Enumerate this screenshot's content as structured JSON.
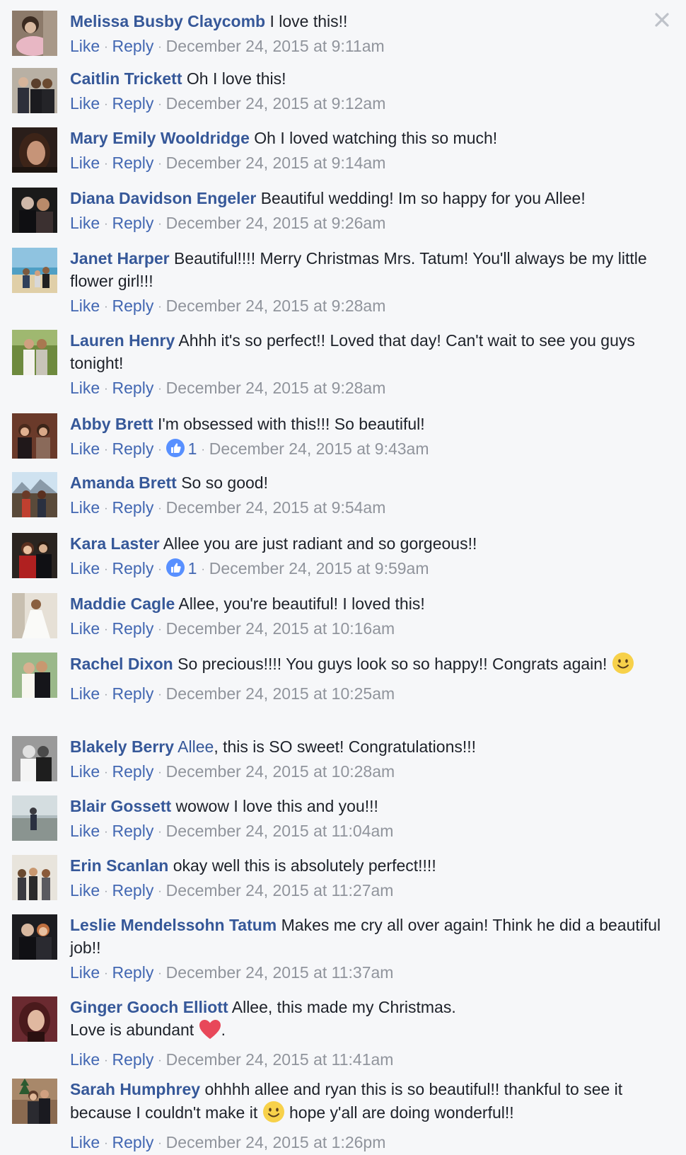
{
  "actions": {
    "like": "Like",
    "reply": "Reply",
    "separator": "·"
  },
  "comments": [
    {
      "author": "Melissa Busby Claycomb",
      "text": "I love this!!",
      "time": "December 24, 2015 at 9:11am"
    },
    {
      "author": "Caitlin Trickett",
      "text": "Oh I love this!",
      "time": "December 24, 2015 at 9:12am"
    },
    {
      "author": "Mary Emily Wooldridge",
      "text": "Oh I loved watching this so much!",
      "time": "December 24, 2015 at 9:14am"
    },
    {
      "author": "Diana Davidson Engeler",
      "text": "Beautiful wedding! Im so happy for you Allee!",
      "time": "December 24, 2015 at 9:26am"
    },
    {
      "author": "Janet Harper",
      "text": "Beautiful!!!! Merry Christmas Mrs. Tatum! You'll always be my little flower girl!!!",
      "time": "December 24, 2015 at 9:28am"
    },
    {
      "author": "Lauren Henry",
      "text": "Ahhh it's so perfect!! Loved that day! Can't wait to see you guys tonight!",
      "time": "December 24, 2015 at 9:28am"
    },
    {
      "author": "Abby Brett",
      "text": "I'm obsessed with this!!! So beautiful!",
      "time": "December 24, 2015 at 9:43am",
      "likes": "1"
    },
    {
      "author": "Amanda Brett",
      "text": "So so good!",
      "time": "December 24, 2015 at 9:54am"
    },
    {
      "author": "Kara Laster",
      "text": "Allee you are just radiant and so gorgeous!!",
      "time": "December 24, 2015 at 9:59am",
      "likes": "1"
    },
    {
      "author": "Maddie Cagle",
      "text": "Allee, you're beautiful! I loved this!",
      "time": "December 24, 2015 at 10:16am"
    },
    {
      "author": "Rachel Dixon",
      "text": "So precious!!!! You guys look so so happy!! Congrats again!",
      "time": "December 24, 2015 at 10:25am",
      "emoji": "smile-emoji"
    },
    {
      "author": "Blakely Berry",
      "mention": "Allee",
      "text": ", this is SO sweet! Congratulations!!!",
      "time": "December 24, 2015 at 10:28am"
    },
    {
      "author": "Blair Gossett",
      "text": "wowow I love this and you!!!",
      "time": "December 24, 2015 at 11:04am"
    },
    {
      "author": "Erin Scanlan",
      "text": "okay well this is absolutely perfect!!!!",
      "time": "December 24, 2015 at 11:27am"
    },
    {
      "author": "Leslie Mendelssohn Tatum",
      "text": "Makes me cry all over again! Think he did a beautiful job!!",
      "time": "December 24, 2015 at 11:37am"
    },
    {
      "author": "Ginger Gooch Elliott",
      "text": "Allee, this made my Christmas.",
      "text2": "Love is abundant",
      "text3": ".",
      "time": "December 24, 2015 at 11:41am",
      "emoji": "heart-emoji"
    },
    {
      "author": "Sarah Humphrey",
      "text": "ohhhh allee and ryan this is so beautiful!! thankful to see it because I couldn't make it",
      "text2": "hope y'all are doing wonderful!!",
      "time": "December 24, 2015 at 1:26pm",
      "emoji": "smile-emoji"
    }
  ],
  "colors": {
    "background": "#f6f7f9",
    "author": "#365899",
    "action": "#4267b2",
    "meta": "#90949c",
    "text": "#1d2129"
  },
  "icons": {
    "close": "close-icon",
    "like_reaction": "thumbs-up-icon"
  }
}
